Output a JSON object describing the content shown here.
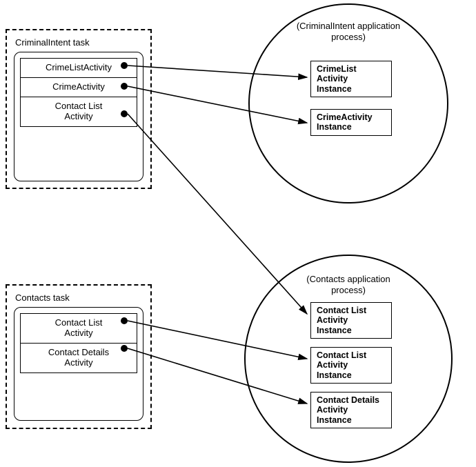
{
  "task1": {
    "title": "CriminalIntent task",
    "items": [
      "CrimeListActivity",
      "CrimeActivity",
      "Contact List\nActivity"
    ]
  },
  "task2": {
    "title": "Contacts task",
    "items": [
      "Contact List\nActivity",
      "Contact Details\nActivity"
    ]
  },
  "process1": {
    "label": "(CriminalIntent application\nprocess)",
    "instances": [
      "CrimeList\nActivity\nInstance",
      "CrimeActivity\nInstance"
    ]
  },
  "process2": {
    "label": "(Contacts application\nprocess)",
    "instances": [
      "Contact List\nActivity\nInstance",
      "Contact List\nActivity\nInstance",
      "Contact Details\nActivity\nInstance"
    ]
  }
}
